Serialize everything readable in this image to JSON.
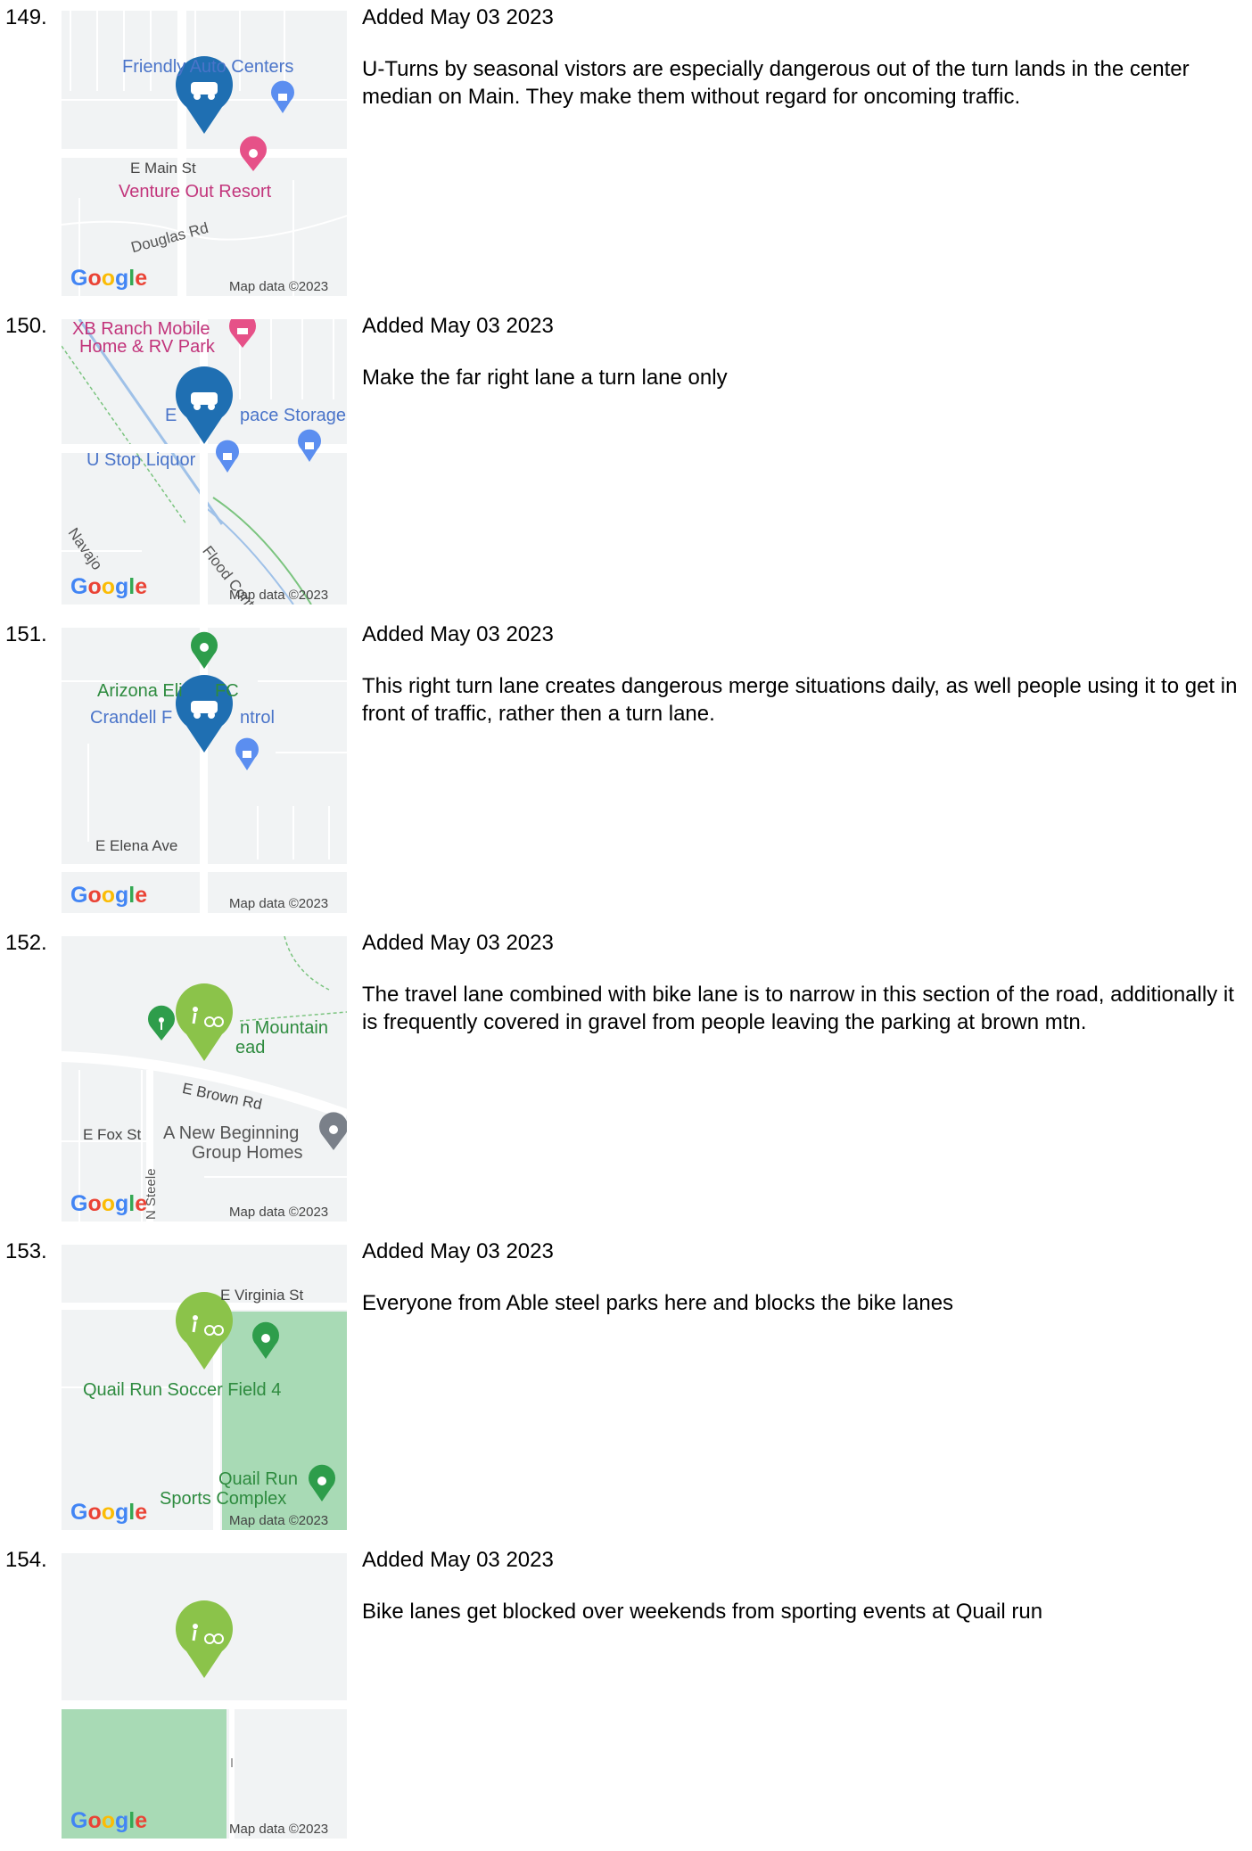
{
  "entries": [
    {
      "number": "149.",
      "added": "Added May 03 2023",
      "comment": "U-Turns by seasonal vistors are especially dangerous out of the turn lands in the center median on Main. They make them without regard for oncoming traffic.",
      "map": {
        "labels": [
          "Friendly Auto Centers",
          "E Main St",
          "Venture Out Resort",
          "Douglas Rd"
        ],
        "marker_icon": "car-icon",
        "marker_color": "#1f6fb2"
      }
    },
    {
      "number": "150.",
      "added": "Added May 03 2023",
      "comment": "Make the far right lane a turn lane only",
      "map": {
        "labels": [
          "XB Ranch Mobile",
          "Home & RV Park",
          "E",
          "pace Storage",
          "U Stop Liquor",
          "Flood Control",
          "Navajo"
        ],
        "marker_icon": "car-icon",
        "marker_color": "#1f6fb2"
      }
    },
    {
      "number": "151.",
      "added": "Added May 03 2023",
      "comment": "This right turn lane creates dangerous merge situations daily, as well people using it to get in front of traffic, rather then a turn lane.",
      "map": {
        "labels": [
          "Arizona Eli",
          "FC",
          "Crandell F",
          "ntrol",
          "E Elena Ave"
        ],
        "marker_icon": "car-icon",
        "marker_color": "#1f6fb2"
      }
    },
    {
      "number": "152.",
      "added": "Added May 03 2023",
      "comment": "The travel lane combined with bike lane is to narrow in this section of the road, additionally it is frequently covered in gravel from people leaving the parking at brown mtn.",
      "map": {
        "labels": [
          "n Mountain",
          "ead",
          "E Brown Rd",
          "E Fox St",
          "A New Beginning",
          "Group Homes",
          "N Steele"
        ],
        "marker_icon": "pedestrian-bike-icon",
        "marker_color": "#8bc34a"
      }
    },
    {
      "number": "153.",
      "added": "Added May 03 2023",
      "comment": "Everyone from Able steel parks here and blocks the bike lanes",
      "map": {
        "labels": [
          "E Virginia St",
          "Quail Run Soccer Field 4",
          "Quail Run",
          "Sports Complex"
        ],
        "marker_icon": "pedestrian-bike-icon",
        "marker_color": "#8bc34a"
      }
    },
    {
      "number": "154.",
      "added": "Added May 03 2023",
      "comment": "Bike lanes get blocked over weekends from sporting events at Quail run",
      "map": {
        "labels": [],
        "marker_icon": "pedestrian-bike-icon",
        "marker_color": "#8bc34a"
      }
    }
  ],
  "map_common": {
    "google_logo": "Google",
    "attribution": "Map data ©2023"
  }
}
